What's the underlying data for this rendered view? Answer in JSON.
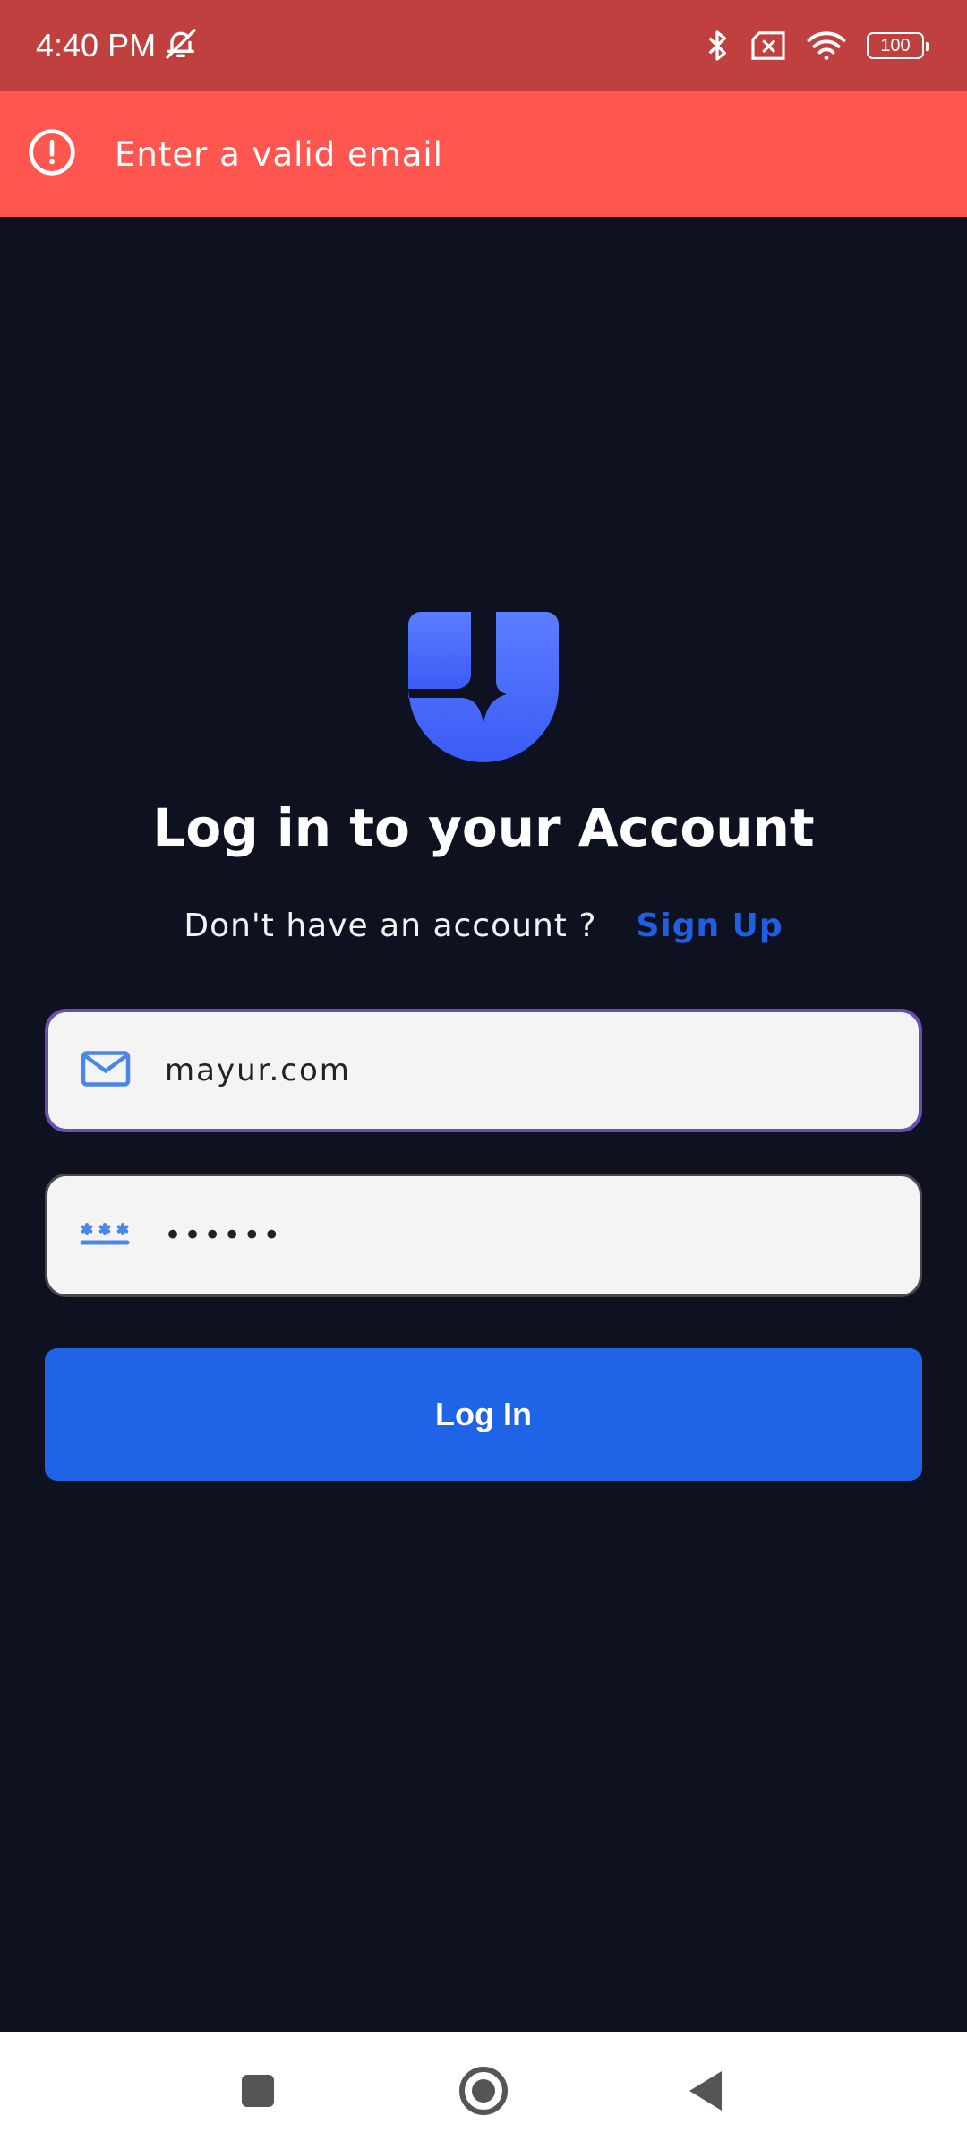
{
  "status_bar": {
    "time": "4:40 PM",
    "icons": [
      "notifications-off-icon",
      "bluetooth-icon",
      "sim-off-icon",
      "wifi-icon",
      "battery-icon"
    ],
    "battery_level": "100"
  },
  "error_banner": {
    "icon": "alert-circle-icon",
    "message": "Enter a valid email"
  },
  "login": {
    "logo": "app-logo",
    "title": "Log in to your Account",
    "signup_prompt": "Don't have an account ?",
    "signup_link": "Sign Up",
    "email_field": {
      "icon": "mail-icon",
      "value": "mayur.com"
    },
    "password_field": {
      "icon": "password-icon",
      "value": "••••••"
    },
    "login_button": "Log In"
  },
  "navigation": {
    "items": [
      "recents-button",
      "home-button",
      "back-button"
    ]
  },
  "colors": {
    "status_bar": "#c03f3f",
    "error_banner": "#ff5650",
    "background": "#0d1120",
    "accent": "#1f63e6",
    "link": "#1f5fe0"
  }
}
